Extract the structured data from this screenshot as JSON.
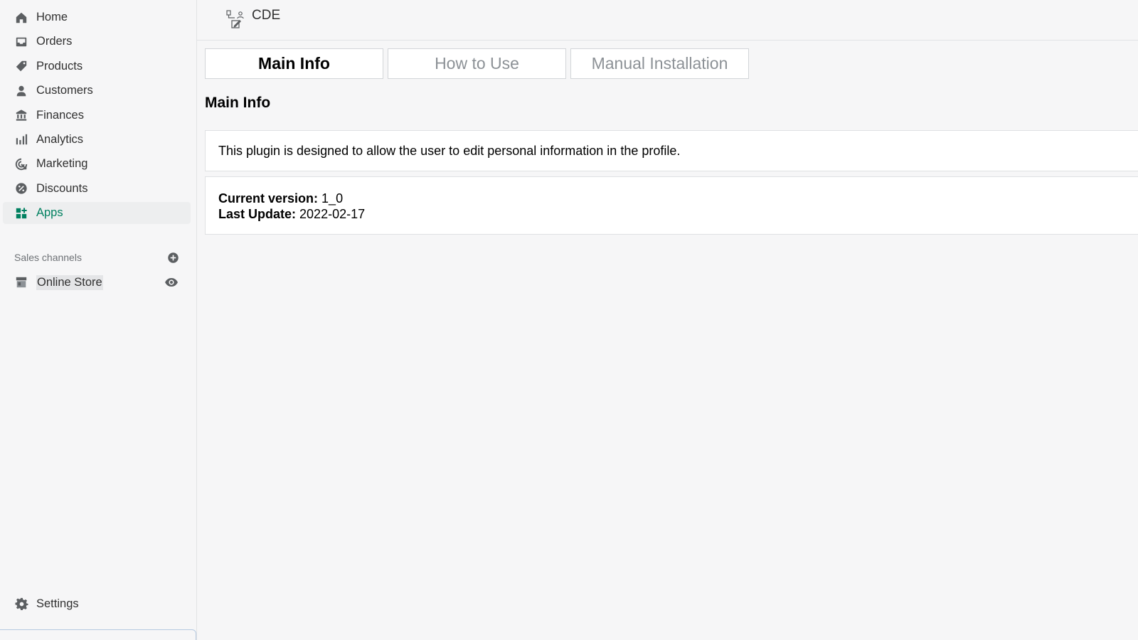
{
  "sidebar": {
    "items": [
      {
        "label": "Home",
        "icon": "home-icon"
      },
      {
        "label": "Orders",
        "icon": "inbox-icon"
      },
      {
        "label": "Products",
        "icon": "tag-icon"
      },
      {
        "label": "Customers",
        "icon": "person-icon"
      },
      {
        "label": "Finances",
        "icon": "bank-icon"
      },
      {
        "label": "Analytics",
        "icon": "bar-chart-icon"
      },
      {
        "label": "Marketing",
        "icon": "target-icon"
      },
      {
        "label": "Discounts",
        "icon": "discount-icon"
      },
      {
        "label": "Apps",
        "icon": "apps-icon",
        "active": true
      }
    ],
    "sales_channels_label": "Sales channels",
    "online_store_label": "Online Store",
    "settings_label": "Settings"
  },
  "header": {
    "app_title": "CDE"
  },
  "tabs": [
    {
      "label": "Main Info",
      "active": true
    },
    {
      "label": "How to Use",
      "active": false
    },
    {
      "label": "Manual Installation",
      "active": false
    }
  ],
  "main": {
    "section_title": "Main Info",
    "description": "This plugin is designed to allow the user to edit personal information in the profile.",
    "current_version_label": "Current version:",
    "current_version_value": "1_0",
    "last_update_label": "Last Update:",
    "last_update_value": "2022-02-17"
  },
  "colors": {
    "accent": "#008060",
    "sidebar_bg": "#f6f6f7",
    "icon": "#5c5f62"
  }
}
